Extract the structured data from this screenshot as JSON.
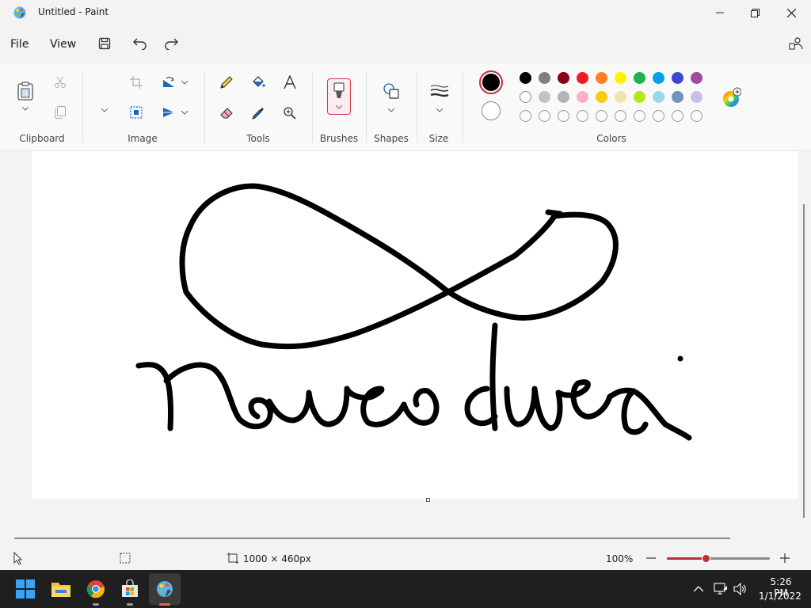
{
  "window": {
    "title": "Untitled - Paint"
  },
  "menu": {
    "file": "File",
    "view": "View"
  },
  "ribbon": {
    "groups": {
      "clipboard": "Clipboard",
      "image": "Image",
      "tools": "Tools",
      "brushes": "Brushes",
      "shapes": "Shapes",
      "size": "Size",
      "colors": "Colors"
    }
  },
  "colors": {
    "primary": "#000000",
    "secondary": "#ffffff",
    "palette_row1": [
      "#000000",
      "#7f7f7f",
      "#880015",
      "#ed1c24",
      "#ff7f27",
      "#fff200",
      "#22b14c",
      "#00a2e8",
      "#3f48cc",
      "#a349a4"
    ],
    "palette_row2": [
      "#ffffff",
      "#c3c3c3",
      "#b4b4b4",
      "#ffaec9",
      "#ffc90e",
      "#efe4b0",
      "#b5e61d",
      "#99d9ea",
      "#7092be",
      "#c8bfe7"
    ]
  },
  "status": {
    "canvas_size": "1000 × 460px",
    "zoom": "100%",
    "zoom_slider_fraction": 0.38
  },
  "taskbar": {
    "time": "5:26 PM",
    "date": "1/1/2022"
  }
}
